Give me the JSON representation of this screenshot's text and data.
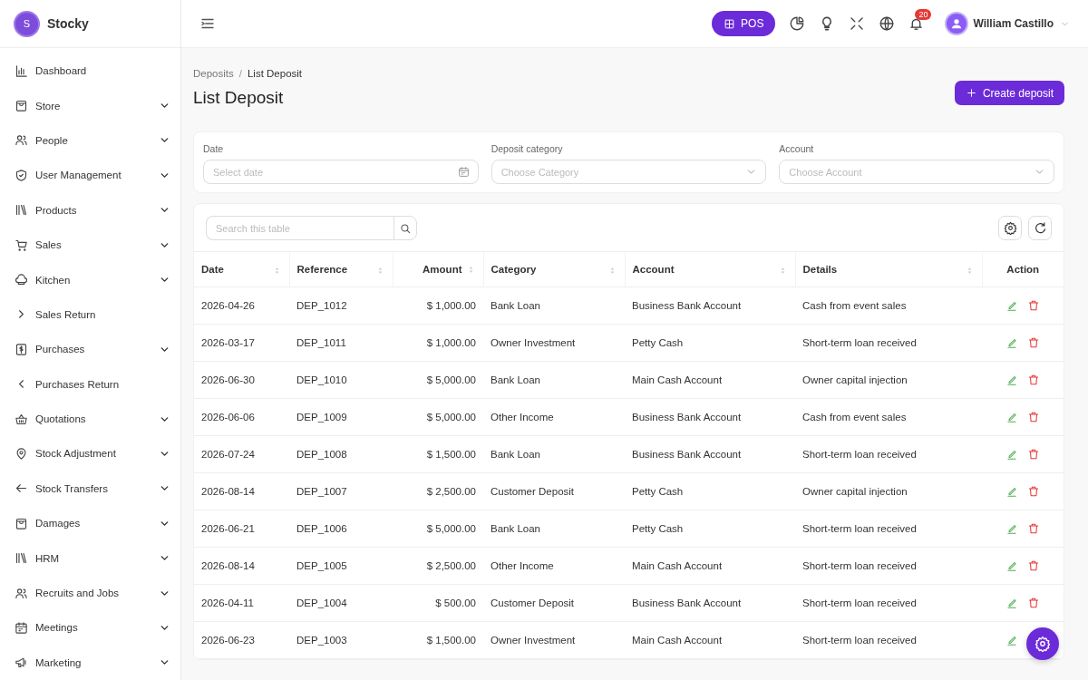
{
  "brand": {
    "logo_letter": "S",
    "name": "Stocky"
  },
  "sidebar": {
    "items": [
      {
        "label": "Dashboard",
        "expandable": false
      },
      {
        "label": "Store",
        "expandable": true
      },
      {
        "label": "People",
        "expandable": true
      },
      {
        "label": "User Management",
        "expandable": true
      },
      {
        "label": "Products",
        "expandable": true
      },
      {
        "label": "Sales",
        "expandable": true
      },
      {
        "label": "Kitchen",
        "expandable": true
      },
      {
        "label": "Sales Return",
        "expandable": false
      },
      {
        "label": "Purchases",
        "expandable": true
      },
      {
        "label": "Purchases Return",
        "expandable": false
      },
      {
        "label": "Quotations",
        "expandable": true
      },
      {
        "label": "Stock Adjustment",
        "expandable": true
      },
      {
        "label": "Stock Transfers",
        "expandable": true
      },
      {
        "label": "Damages",
        "expandable": true
      },
      {
        "label": "HRM",
        "expandable": true
      },
      {
        "label": "Recruits and Jobs",
        "expandable": true
      },
      {
        "label": "Meetings",
        "expandable": true
      },
      {
        "label": "Marketing",
        "expandable": true
      }
    ]
  },
  "header": {
    "pos_button": "POS",
    "notification_count": "20",
    "user_name": "William Castillo"
  },
  "breadcrumb": [
    "Deposits",
    "List Deposit"
  ],
  "breadcrumb_separator": "/",
  "page_title": "List Deposit",
  "create_button": "Create deposit",
  "filters": [
    {
      "label": "Date",
      "placeholder": "Select date",
      "kind": "date"
    },
    {
      "label": "Deposit category",
      "placeholder": "Choose Category",
      "kind": "select"
    },
    {
      "label": "Account",
      "placeholder": "Choose Account",
      "kind": "select"
    }
  ],
  "table": {
    "search_placeholder": "Search this table",
    "columns": [
      {
        "label": "Date"
      },
      {
        "label": "Reference"
      },
      {
        "label": "Amount"
      },
      {
        "label": "Category"
      },
      {
        "label": "Account"
      },
      {
        "label": "Details"
      },
      {
        "label": "Action"
      }
    ],
    "rows": [
      [
        "2026-04-26",
        "DEP_1012",
        "$ 1,000.00",
        "Bank Loan",
        "Business Bank Account",
        "Cash from event sales"
      ],
      [
        "2026-03-17",
        "DEP_1011",
        "$ 1,000.00",
        "Owner Investment",
        "Petty Cash",
        "Short-term loan received"
      ],
      [
        "2026-06-30",
        "DEP_1010",
        "$ 5,000.00",
        "Bank Loan",
        "Main Cash Account",
        "Owner capital injection"
      ],
      [
        "2026-06-06",
        "DEP_1009",
        "$ 5,000.00",
        "Other Income",
        "Business Bank Account",
        "Cash from event sales"
      ],
      [
        "2026-07-24",
        "DEP_1008",
        "$ 1,500.00",
        "Bank Loan",
        "Business Bank Account",
        "Short-term loan received"
      ],
      [
        "2026-08-14",
        "DEP_1007",
        "$ 2,500.00",
        "Customer Deposit",
        "Petty Cash",
        "Owner capital injection"
      ],
      [
        "2026-06-21",
        "DEP_1006",
        "$ 5,000.00",
        "Bank Loan",
        "Petty Cash",
        "Short-term loan received"
      ],
      [
        "2026-08-14",
        "DEP_1005",
        "$ 2,500.00",
        "Other Income",
        "Main Cash Account",
        "Short-term loan received"
      ],
      [
        "2026-04-11",
        "DEP_1004",
        "$ 500.00",
        "Customer Deposit",
        "Business Bank Account",
        "Short-term loan received"
      ],
      [
        "2026-06-23",
        "DEP_1003",
        "$ 1,500.00",
        "Owner Investment",
        "Main Cash Account",
        "Short-term loan received"
      ]
    ]
  }
}
